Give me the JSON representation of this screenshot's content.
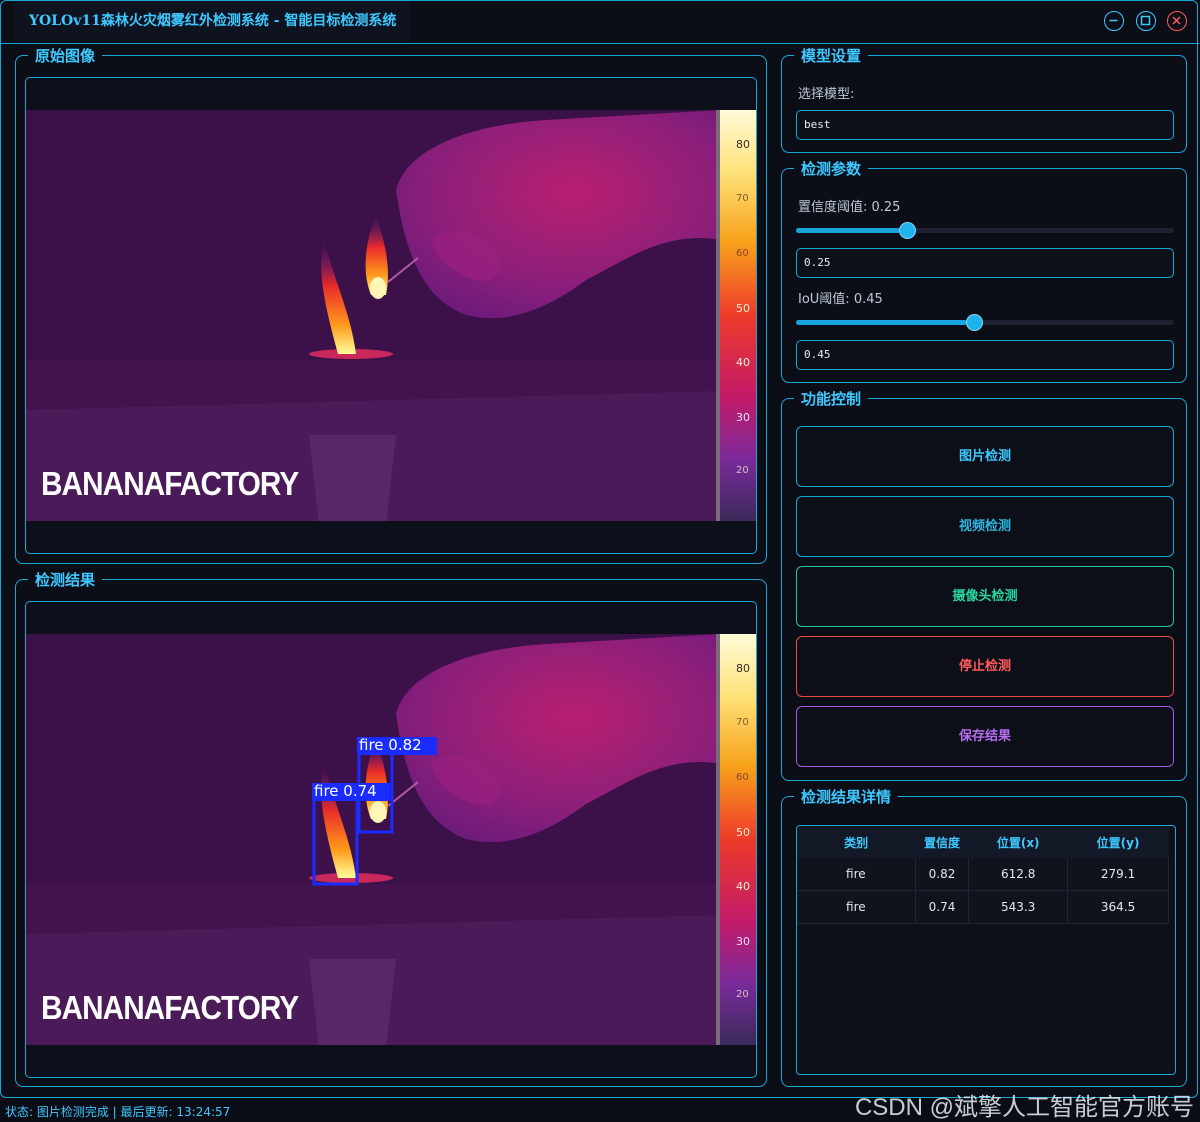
{
  "window": {
    "title": "YOLOv11森林火灾烟雾红外检测系统 - 智能目标检测系统"
  },
  "panels": {
    "original": {
      "title": "原始图像"
    },
    "result": {
      "title": "检测结果"
    },
    "model": {
      "title": "模型设置",
      "select_label": "选择模型:",
      "selected": "best"
    },
    "params": {
      "title": "检测参数",
      "conf_label": "置信度阈值: 0.25",
      "conf_value": "0.25",
      "conf": 0.25,
      "iou_label": "IoU阈值: 0.45",
      "iou_value": "0.45",
      "iou": 0.45
    },
    "controls": {
      "title": "功能控制",
      "buttons": [
        "图片检测",
        "视频检测",
        "摄像头检测",
        "停止检测",
        "保存结果"
      ]
    },
    "details": {
      "title": "检测结果详情",
      "headers": [
        "类别",
        "置信度",
        "位置(x)",
        "位置(y)"
      ],
      "rows": [
        [
          "fire",
          "0.82",
          "612.8",
          "279.1"
        ],
        [
          "fire",
          "0.74",
          "543.3",
          "364.5"
        ]
      ]
    }
  },
  "image": {
    "watermark_text": "BANANAFACTORY",
    "scale_ticks": [
      "80",
      "70",
      "60",
      "50",
      "40",
      "30",
      "20"
    ],
    "detections": [
      {
        "label": "fire 0.82"
      },
      {
        "label": "fire 0.74"
      }
    ]
  },
  "status": "状态: 图片检测完成 | 最后更新: 13:24:57",
  "watermark": "CSDN @斌擎人工智能官方账号",
  "colors": {
    "accent": "#19a7d8",
    "stop": "#e84a4a",
    "camera": "#27d6a0",
    "save": "#b86cf0",
    "box": "#1a2cff"
  }
}
